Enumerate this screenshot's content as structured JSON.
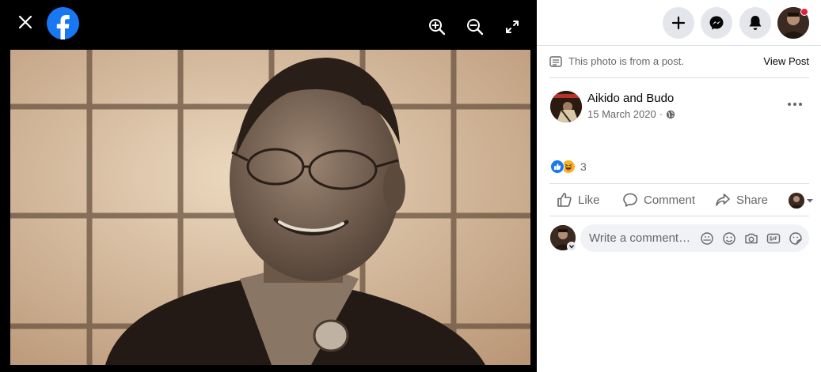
{
  "viewer": {
    "close_icon": "close-icon",
    "logo": "facebook-logo",
    "zoom_in_icon": "zoom-in-icon",
    "zoom_out_icon": "zoom-out-icon",
    "fullscreen_icon": "fullscreen-icon",
    "photo_subject": "photo"
  },
  "topbar": {
    "create_icon": "plus-icon",
    "messenger_icon": "messenger-icon",
    "notifications_icon": "bell-icon",
    "account_avatar": "account-avatar",
    "notification_dot_color": "#e41e3f"
  },
  "post": {
    "note": "This photo is from a post.",
    "view_post": "View Post",
    "page_name": "Aikido and Budo",
    "date": "15 March 2020",
    "audience_icon": "globe-icon",
    "reaction_count": "3",
    "reactions": [
      "like",
      "haha"
    ]
  },
  "actions": {
    "like": "Like",
    "comment": "Comment",
    "share": "Share"
  },
  "comment": {
    "placeholder": "Write a comment…",
    "icons": [
      "avatar-sticker-icon",
      "emoji-icon",
      "camera-icon",
      "gif-icon",
      "sticker-icon"
    ]
  },
  "colors": {
    "brand": "#1877f2",
    "text_secondary": "#65676b",
    "button_bg": "#e4e6eb"
  }
}
